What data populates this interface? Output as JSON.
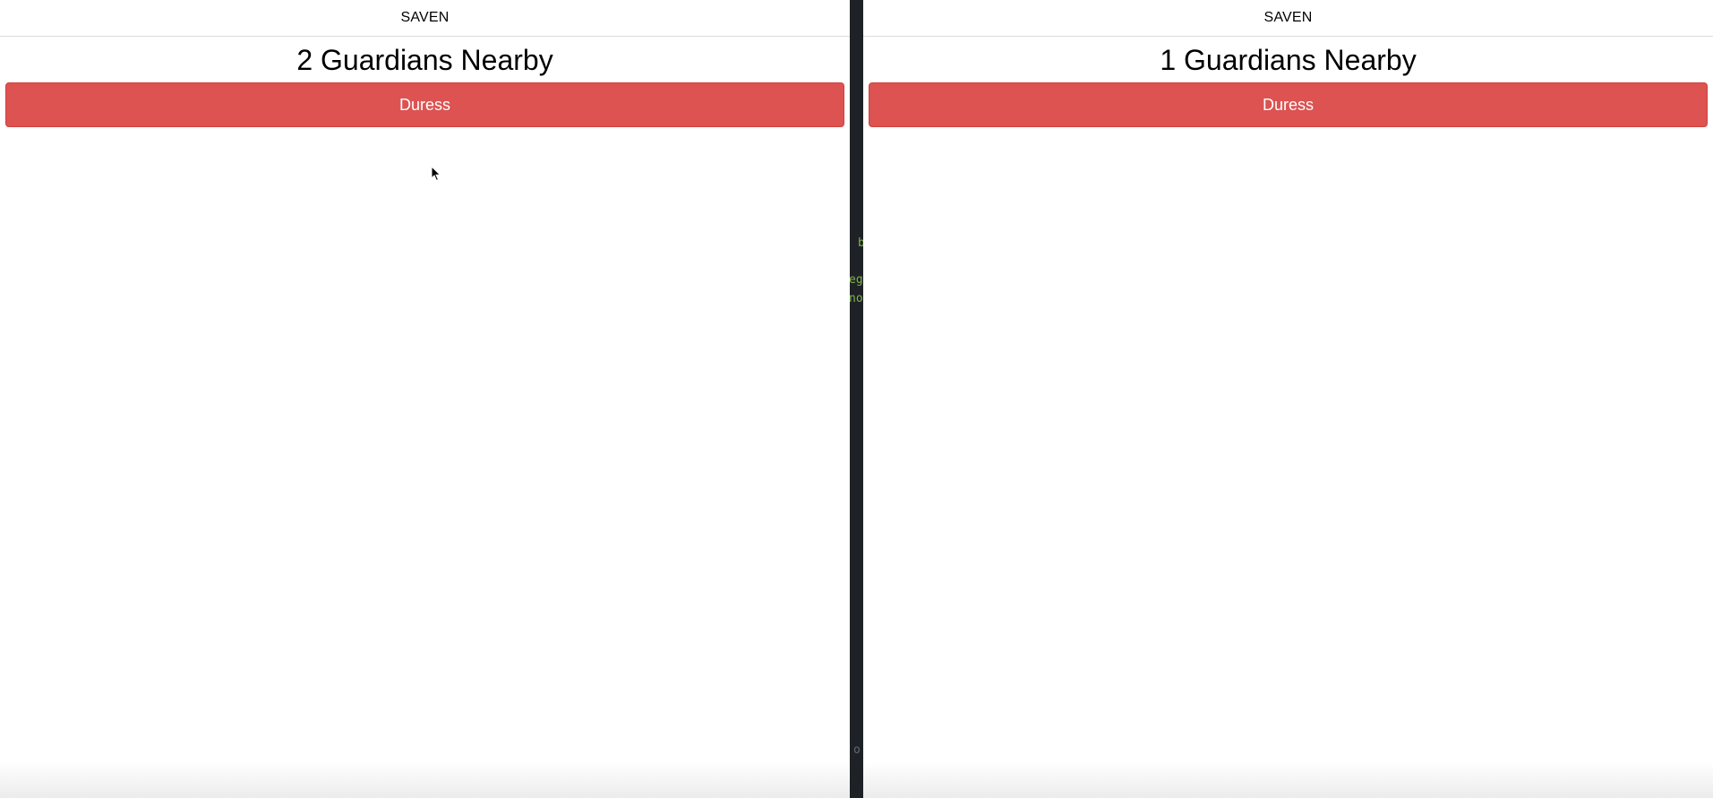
{
  "panes": [
    {
      "app_title": "SAVEN",
      "heading": "2 Guardians Nearby",
      "duress_label": "Duress"
    },
    {
      "app_title": "SAVEN",
      "heading": "1 Guardians Nearby",
      "duress_label": "Duress"
    }
  ],
  "terminal": {
    "fragments": [
      "b",
      "eg",
      "no",
      "o"
    ]
  },
  "colors": {
    "duress": "#dc5351",
    "divider": "#1e2227",
    "terminal_text": "#7fb347"
  },
  "icons": {
    "pointer": "mouse-pointer-icon"
  }
}
